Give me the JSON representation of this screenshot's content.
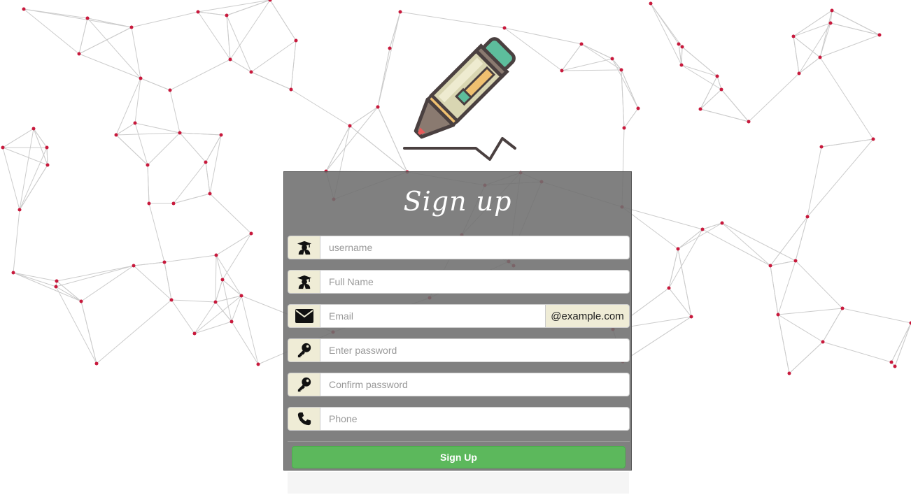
{
  "form": {
    "title": "Sign up",
    "fields": [
      {
        "name": "username",
        "placeholder": "username",
        "icon": "graduate-icon",
        "value": ""
      },
      {
        "name": "full_name",
        "placeholder": "Full Name",
        "icon": "graduate-icon",
        "value": ""
      },
      {
        "name": "email",
        "placeholder": "Email",
        "icon": "envelope-icon",
        "value": "",
        "suffix": "@example.com"
      },
      {
        "name": "password",
        "placeholder": "Enter password",
        "icon": "key-icon",
        "value": ""
      },
      {
        "name": "confirm_password",
        "placeholder": "Confirm password",
        "icon": "key-icon",
        "value": ""
      },
      {
        "name": "phone",
        "placeholder": "Phone",
        "icon": "phone-icon",
        "value": ""
      }
    ],
    "submit_label": "Sign Up"
  },
  "logo": {
    "icon": "pencil-icon"
  },
  "colors": {
    "submit": "#5cb85c",
    "addon": "#efecd6",
    "network_node": "#c8193c",
    "network_line": "#cccccc",
    "panel": "#6e6e6e"
  }
}
